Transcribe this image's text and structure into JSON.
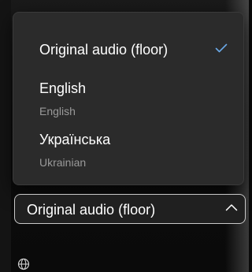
{
  "menu": {
    "items": [
      {
        "label": "Original audio (floor)",
        "sublabel": "",
        "selected": true
      },
      {
        "label": "English",
        "sublabel": "English",
        "selected": false
      },
      {
        "label": "Українська",
        "sublabel": "Ukrainian",
        "selected": false
      }
    ]
  },
  "dropdown": {
    "value": "Original audio (floor)",
    "icon": "chevron-up-icon",
    "expanded": true
  },
  "footer": {
    "icon": "globe-icon"
  },
  "colors": {
    "menu_bg": "#2b2b2b",
    "check_accent": "#6aa8e6",
    "secondary_text": "#9a9a9a",
    "dropdown_border": "#c9c9c9"
  }
}
